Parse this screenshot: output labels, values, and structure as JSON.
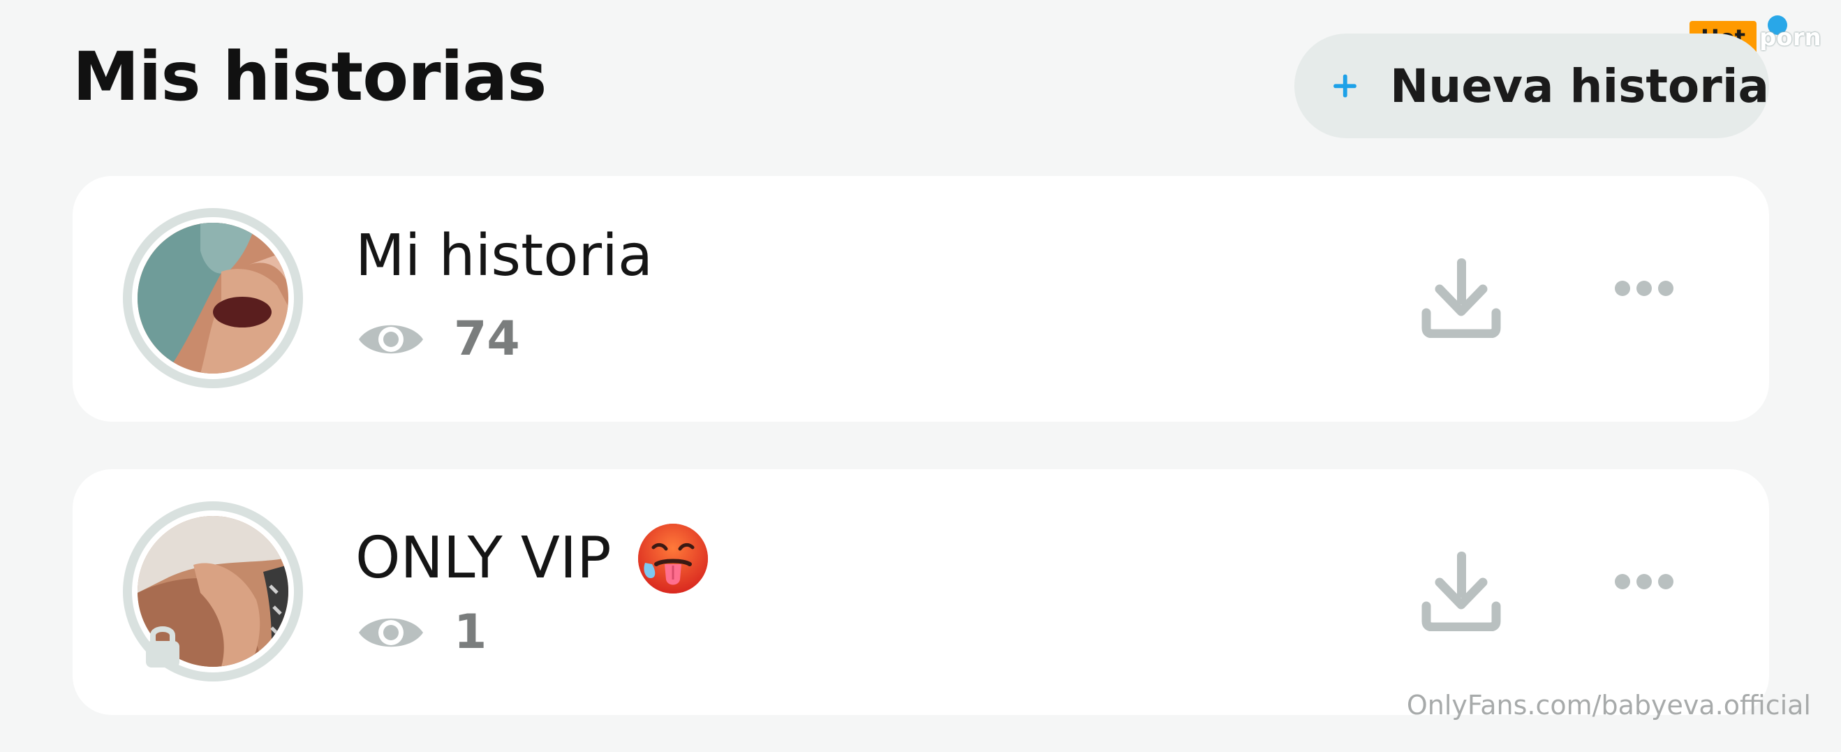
{
  "header": {
    "title": "Mis historias",
    "new_story_label": "Nueva historia",
    "new_story_icon": "plus-icon"
  },
  "stories": [
    {
      "title": "Mi historia",
      "views": "74",
      "locked": false,
      "icons": [
        "eye-icon",
        "download-icon",
        "more-icon"
      ]
    },
    {
      "title": "ONLY VIP",
      "emoji": "hot-face-emoji",
      "views": "1",
      "locked": true,
      "icons": [
        "lock-icon",
        "eye-icon",
        "download-icon",
        "more-icon"
      ]
    }
  ],
  "watermark": {
    "text": "OnlyFans.com/babyeva.official",
    "brand_hot": "Hot",
    "brand_porn": "porn"
  },
  "colors": {
    "background": "#f5f6f6",
    "card": "#ffffff",
    "button_bg": "#e6ebea",
    "accent_blue": "#1da1e8",
    "icon_gray": "#b9c0c0",
    "text": "#151515",
    "count_text": "#7a7d7d"
  }
}
